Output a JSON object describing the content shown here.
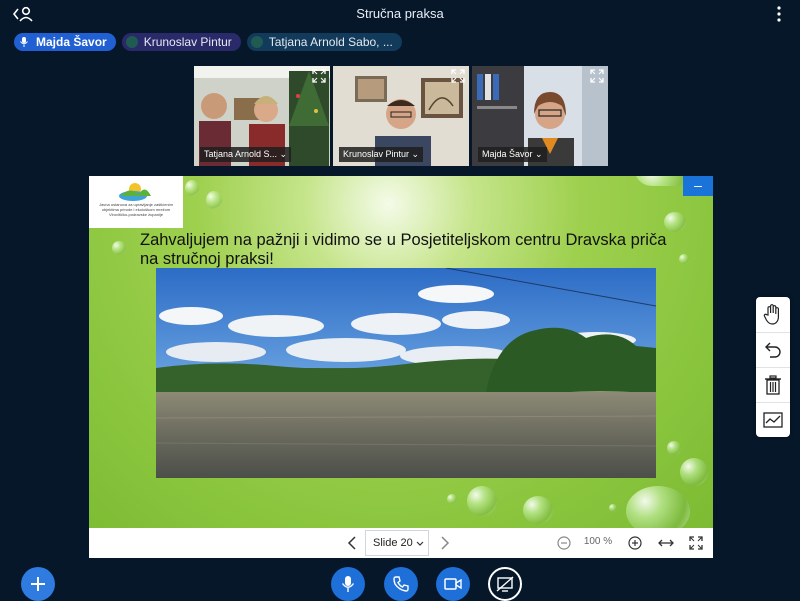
{
  "header": {
    "title": "Stručna praksa"
  },
  "participants": [
    {
      "name": "Majda Šavor",
      "talking": true
    },
    {
      "name": "Krunoslav Pintur",
      "talking": false
    },
    {
      "name": "Tatjana Arnold Sabo, ...",
      "talking": false
    }
  ],
  "videos": [
    {
      "name": "Tatjana Arnold S...",
      "active": false
    },
    {
      "name": "Krunoslav Pintur",
      "active": false
    },
    {
      "name": "Majda Šavor",
      "active": true
    }
  ],
  "slide": {
    "heading": "Zahvaljujem na pažnji i vidimo se u Posjetiteljskom centru Dravska priča na stručnoj praksi!",
    "logo_text": "Javna ustanova za upravljanje zaštićenim\nobjektima prirode i ekološkom mrežom\nVirovitičko-podravske županije"
  },
  "controls": {
    "slide_select": "Slide 20",
    "zoom": "100 %"
  },
  "colors": {
    "background": "#06172a",
    "accent": "#2f7be0",
    "slide_green": "#8cc63f"
  },
  "icons": {
    "header_left": "user-back-icon",
    "header_right": "kebab-menu-icon",
    "tools": [
      "hand-icon",
      "undo-icon",
      "trash-icon",
      "chart-icon"
    ],
    "bottom": [
      "plus-icon",
      "microphone-icon",
      "phone-icon",
      "video-camera-icon",
      "screen-share-off-icon"
    ]
  }
}
